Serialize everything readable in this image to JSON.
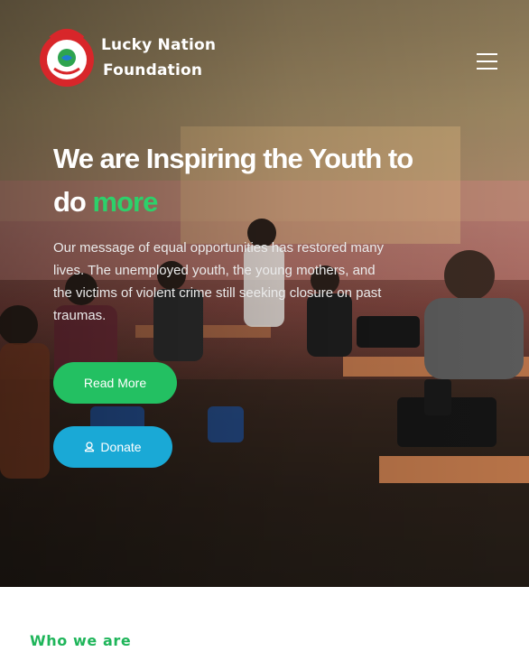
{
  "header": {
    "brand_line1": "Lucky Nation",
    "brand_line2": "Foundation",
    "menu_icon": "hamburger-menu-icon"
  },
  "hero": {
    "headline_part1": "We are Inspiring the Youth to do ",
    "headline_accent": "more",
    "lead": "Our message of equal opportunities has restored many lives. The unemployed youth, the young mothers, and the victims of violent crime still seeking closure on past traumas.",
    "read_more_label": "Read More",
    "donate_label": "Donate",
    "donate_icon": "donate-hand-icon"
  },
  "section": {
    "label": "Who we are"
  },
  "colors": {
    "accent_green": "#2dd06a",
    "button_green": "#23c062",
    "button_blue": "#1aa9d6",
    "section_green": "#1fb55a"
  }
}
